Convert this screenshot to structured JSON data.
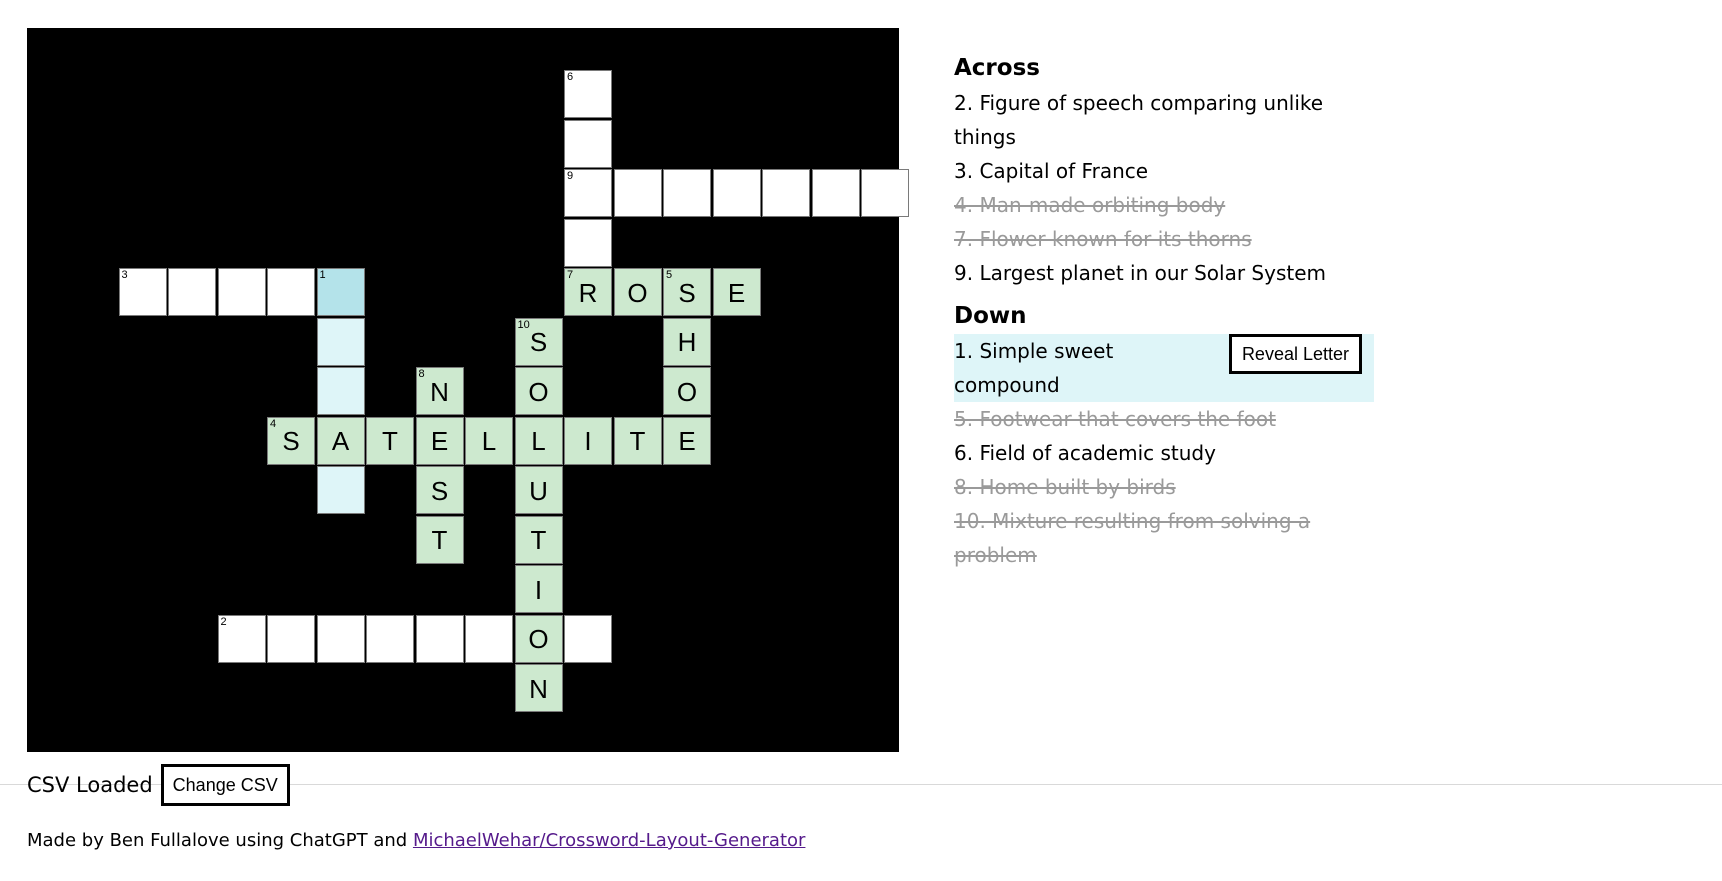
{
  "grid": {
    "cells": [
      {
        "col": 10,
        "row": 0,
        "number": "6",
        "letter": "",
        "state": "empty"
      },
      {
        "col": 10,
        "row": 1,
        "number": "",
        "letter": "",
        "state": "empty"
      },
      {
        "col": 10,
        "row": 2,
        "number": "9",
        "letter": "",
        "state": "empty"
      },
      {
        "col": 11,
        "row": 2,
        "number": "",
        "letter": "",
        "state": "empty"
      },
      {
        "col": 12,
        "row": 2,
        "number": "",
        "letter": "",
        "state": "empty"
      },
      {
        "col": 13,
        "row": 2,
        "number": "",
        "letter": "",
        "state": "empty"
      },
      {
        "col": 14,
        "row": 2,
        "number": "",
        "letter": "",
        "state": "empty"
      },
      {
        "col": 15,
        "row": 2,
        "number": "",
        "letter": "",
        "state": "empty"
      },
      {
        "col": 16,
        "row": 2,
        "number": "",
        "letter": "",
        "state": "empty"
      },
      {
        "col": 10,
        "row": 3,
        "number": "",
        "letter": "",
        "state": "empty"
      },
      {
        "col": 1,
        "row": 4,
        "number": "3",
        "letter": "",
        "state": "empty"
      },
      {
        "col": 2,
        "row": 4,
        "number": "",
        "letter": "",
        "state": "empty"
      },
      {
        "col": 3,
        "row": 4,
        "number": "",
        "letter": "",
        "state": "empty"
      },
      {
        "col": 4,
        "row": 4,
        "number": "",
        "letter": "",
        "state": "empty"
      },
      {
        "col": 5,
        "row": 4,
        "number": "1",
        "letter": "",
        "state": "selected"
      },
      {
        "col": 10,
        "row": 4,
        "number": "7",
        "letter": "R",
        "state": "solved"
      },
      {
        "col": 11,
        "row": 4,
        "number": "",
        "letter": "O",
        "state": "solved"
      },
      {
        "col": 12,
        "row": 4,
        "number": "5",
        "letter": "S",
        "state": "solved"
      },
      {
        "col": 13,
        "row": 4,
        "number": "",
        "letter": "E",
        "state": "solved"
      },
      {
        "col": 5,
        "row": 5,
        "number": "",
        "letter": "",
        "state": "word"
      },
      {
        "col": 9,
        "row": 5,
        "number": "10",
        "letter": "S",
        "state": "solved"
      },
      {
        "col": 12,
        "row": 5,
        "number": "",
        "letter": "H",
        "state": "solved"
      },
      {
        "col": 5,
        "row": 6,
        "number": "",
        "letter": "",
        "state": "word"
      },
      {
        "col": 7,
        "row": 6,
        "number": "8",
        "letter": "N",
        "state": "solved"
      },
      {
        "col": 9,
        "row": 6,
        "number": "",
        "letter": "O",
        "state": "solved"
      },
      {
        "col": 12,
        "row": 6,
        "number": "",
        "letter": "O",
        "state": "solved"
      },
      {
        "col": 4,
        "row": 7,
        "number": "4",
        "letter": "S",
        "state": "solved"
      },
      {
        "col": 5,
        "row": 7,
        "number": "",
        "letter": "A",
        "state": "solved"
      },
      {
        "col": 6,
        "row": 7,
        "number": "",
        "letter": "T",
        "state": "solved"
      },
      {
        "col": 7,
        "row": 7,
        "number": "",
        "letter": "E",
        "state": "solved"
      },
      {
        "col": 8,
        "row": 7,
        "number": "",
        "letter": "L",
        "state": "solved"
      },
      {
        "col": 9,
        "row": 7,
        "number": "",
        "letter": "L",
        "state": "solved"
      },
      {
        "col": 10,
        "row": 7,
        "number": "",
        "letter": "I",
        "state": "solved"
      },
      {
        "col": 11,
        "row": 7,
        "number": "",
        "letter": "T",
        "state": "solved"
      },
      {
        "col": 12,
        "row": 7,
        "number": "",
        "letter": "E",
        "state": "solved"
      },
      {
        "col": 5,
        "row": 8,
        "number": "",
        "letter": "",
        "state": "word"
      },
      {
        "col": 7,
        "row": 8,
        "number": "",
        "letter": "S",
        "state": "solved"
      },
      {
        "col": 9,
        "row": 8,
        "number": "",
        "letter": "U",
        "state": "solved"
      },
      {
        "col": 7,
        "row": 9,
        "number": "",
        "letter": "T",
        "state": "solved"
      },
      {
        "col": 9,
        "row": 9,
        "number": "",
        "letter": "T",
        "state": "solved"
      },
      {
        "col": 9,
        "row": 10,
        "number": "",
        "letter": "I",
        "state": "solved"
      },
      {
        "col": 3,
        "row": 11,
        "number": "2",
        "letter": "",
        "state": "empty"
      },
      {
        "col": 4,
        "row": 11,
        "number": "",
        "letter": "",
        "state": "empty"
      },
      {
        "col": 5,
        "row": 11,
        "number": "",
        "letter": "",
        "state": "empty"
      },
      {
        "col": 6,
        "row": 11,
        "number": "",
        "letter": "",
        "state": "empty"
      },
      {
        "col": 7,
        "row": 11,
        "number": "",
        "letter": "",
        "state": "empty"
      },
      {
        "col": 8,
        "row": 11,
        "number": "",
        "letter": "",
        "state": "empty"
      },
      {
        "col": 9,
        "row": 11,
        "number": "",
        "letter": "O",
        "state": "solved"
      },
      {
        "col": 10,
        "row": 11,
        "number": "",
        "letter": "",
        "state": "empty"
      },
      {
        "col": 9,
        "row": 12,
        "number": "",
        "letter": "N",
        "state": "solved"
      }
    ]
  },
  "clues": {
    "across_heading": "Across",
    "down_heading": "Down",
    "across": [
      {
        "text": "2. Figure of speech comparing unlike things",
        "state": "open"
      },
      {
        "text": "3. Capital of France",
        "state": "open"
      },
      {
        "text": "4. Man-made orbiting body",
        "state": "done"
      },
      {
        "text": "7. Flower known for its thorns",
        "state": "done"
      },
      {
        "text": "9. Largest planet in our Solar System",
        "state": "open"
      }
    ],
    "down": [
      {
        "text": "1. Simple sweet compound",
        "state": "active"
      },
      {
        "text": "5. Footwear that covers the foot",
        "state": "done"
      },
      {
        "text": "6. Field of academic study",
        "state": "open"
      },
      {
        "text": "8. Home built by birds",
        "state": "done"
      },
      {
        "text": "10. Mixture resulting from solving a problem",
        "state": "done"
      }
    ],
    "reveal_label": "Reveal Letter"
  },
  "status": {
    "text": "CSV Loaded",
    "change_label": "Change CSV"
  },
  "footer": {
    "prefix": "Made by Ben Fullalove using ChatGPT and",
    "link_text": "MichaelWehar/Crossword-Layout-Generator"
  },
  "colors": {
    "board": "#000000",
    "solved": "#cde9cf",
    "selected": "#b4e3ea",
    "word_highlight": "#def5f8",
    "done_clue": "#9a9a9a",
    "link": "#551a8b"
  }
}
